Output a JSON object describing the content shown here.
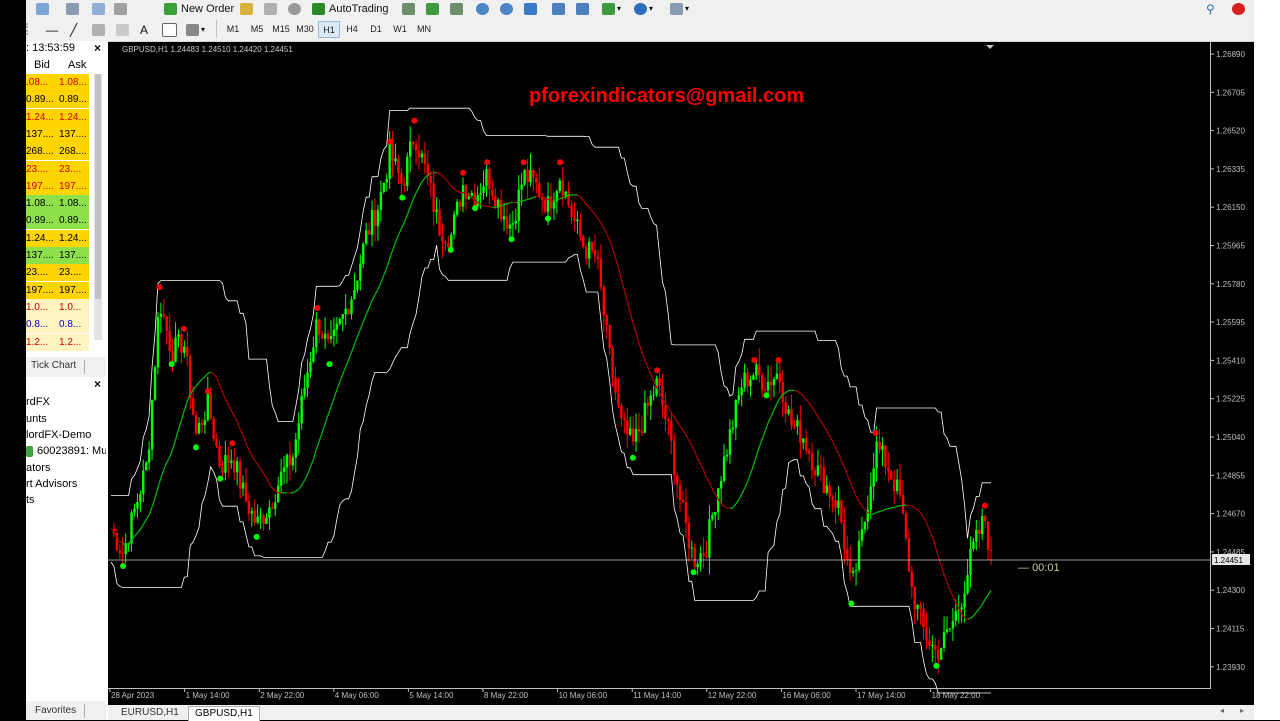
{
  "toolbar": {
    "new_order_label": "New Order",
    "autotrading_label": "AutoTrading",
    "timeframes": [
      "M1",
      "M5",
      "M15",
      "M30",
      "H1",
      "H4",
      "D1",
      "W1",
      "MN"
    ],
    "active_timeframe": "H1"
  },
  "market_watch": {
    "time": ": 13:53:59",
    "close_glyph": "×",
    "col_bid": "Bid",
    "col_ask": "Ask",
    "rows": [
      {
        "bid": ".08...",
        "ask": "1.08...",
        "color": "#ffd400",
        "text": "#d00000"
      },
      {
        "bid": "0.89...",
        "ask": "0.89...",
        "color": "#ffd400",
        "text": "#000000"
      },
      {
        "bid": "1.24...",
        "ask": "1.24...",
        "color": "#ffd400",
        "text": "#d00000"
      },
      {
        "bid": "137....",
        "ask": "137....",
        "color": "#ffd400",
        "text": "#000000"
      },
      {
        "bid": "268....",
        "ask": "268....",
        "color": "#ffd400",
        "text": "#000000"
      },
      {
        "bid": "23....",
        "ask": "23....",
        "color": "#ffd400",
        "text": "#d00000"
      },
      {
        "bid": "197....",
        "ask": "197....",
        "color": "#ffd400",
        "text": "#d00000"
      },
      {
        "bid": "1.08...",
        "ask": "1.08...",
        "color": "#8ee04a",
        "text": "#000000"
      },
      {
        "bid": "0.89...",
        "ask": "0.89...",
        "color": "#8ee04a",
        "text": "#000000"
      },
      {
        "bid": "1.24...",
        "ask": "1.24...",
        "color": "#ffd400",
        "text": "#000000"
      },
      {
        "bid": "137....",
        "ask": "137....",
        "color": "#8ee04a",
        "text": "#000000"
      },
      {
        "bid": "23....",
        "ask": "23....",
        "color": "#ffd400",
        "text": "#000000"
      },
      {
        "bid": "197....",
        "ask": "197....",
        "color": "#ffd400",
        "text": "#000000"
      },
      {
        "bid": "1.0...",
        "ask": "1.0...",
        "color": "#fff3c0",
        "text": "#d00000"
      },
      {
        "bid": "0.8...",
        "ask": "0.8...",
        "color": "#fff3c0",
        "text": "#0000c0"
      },
      {
        "bid": "1.2...",
        "ask": "1.2...",
        "color": "#fff3c0",
        "text": "#d00000"
      }
    ],
    "tick_chart_tab": "Tick Chart"
  },
  "navigator": {
    "close_glyph": "×",
    "items": [
      "rdFX",
      "unts",
      "lordFX-Demo",
      "60023891: Mu",
      "ators",
      "rt Advisors",
      "ts"
    ]
  },
  "favorites_tab": "Favorites",
  "bottom_tabs": [
    "EURUSD,H1",
    "GBPUSD,H1"
  ],
  "active_tab": "GBPUSD,H1",
  "chart": {
    "header": "GBPUSD,H1  1.24483 1.24510 1.24420 1.24451",
    "watermark": "pforexindicators@gmail.com",
    "price_labels": [
      "1.26890",
      "1.26705",
      "1.26520",
      "1.26335",
      "1.26150",
      "1.25965",
      "1.25780",
      "1.25595",
      "1.25410",
      "1.25225",
      "1.25040",
      "1.24855",
      "1.24670",
      "1.24485",
      "1.24300",
      "1.24115",
      "1.23930"
    ],
    "current_price": "1.24451",
    "countdown": "00:01",
    "time_labels": [
      "28 Apr 2023",
      "1 May 14:00",
      "2 May 22:00",
      "4 May 06:00",
      "5 May 14:00",
      "8 May 22:00",
      "10 May 06:00",
      "11 May 14:00",
      "12 May 22:00",
      "16 May 06:00",
      "17 May 14:00",
      "18 May 22:00"
    ],
    "colors": {
      "bull": "#00ff00",
      "bear": "#ff0000",
      "band": "#ffffff",
      "ma_bull": "#00c000",
      "ma_bear": "#b00000",
      "watermark": "#ff0000"
    },
    "price_path": [
      [
        0,
        1.246
      ],
      [
        2,
        1.2448
      ],
      [
        4,
        1.247
      ],
      [
        6,
        1.2492
      ],
      [
        8,
        1.257
      ],
      [
        10,
        1.2545
      ],
      [
        12,
        1.255
      ],
      [
        14,
        1.2505
      ],
      [
        16,
        1.252
      ],
      [
        18,
        1.249
      ],
      [
        20,
        1.2495
      ],
      [
        22,
        1.2475
      ],
      [
        24,
        1.2462
      ],
      [
        26,
        1.247
      ],
      [
        28,
        1.2485
      ],
      [
        30,
        1.2495
      ],
      [
        32,
        1.253
      ],
      [
        34,
        1.256
      ],
      [
        36,
        1.2545
      ],
      [
        38,
        1.256
      ],
      [
        40,
        1.2575
      ],
      [
        42,
        1.26
      ],
      [
        44,
        1.2615
      ],
      [
        46,
        1.264
      ],
      [
        48,
        1.2625
      ],
      [
        50,
        1.265
      ],
      [
        52,
        1.263
      ],
      [
        54,
        1.2605
      ],
      [
        56,
        1.26
      ],
      [
        58,
        1.2625
      ],
      [
        60,
        1.262
      ],
      [
        62,
        1.263
      ],
      [
        64,
        1.2615
      ],
      [
        66,
        1.2605
      ],
      [
        68,
        1.263
      ],
      [
        70,
        1.2625
      ],
      [
        72,
        1.2615
      ],
      [
        74,
        1.263
      ],
      [
        76,
        1.261
      ],
      [
        78,
        1.2595
      ],
      [
        80,
        1.259
      ],
      [
        82,
        1.2545
      ],
      [
        84,
        1.251
      ],
      [
        86,
        1.25
      ],
      [
        88,
        1.2515
      ],
      [
        90,
        1.253
      ],
      [
        92,
        1.2505
      ],
      [
        94,
        1.247
      ],
      [
        96,
        1.2445
      ],
      [
        98,
        1.245
      ],
      [
        100,
        1.248
      ],
      [
        102,
        1.2505
      ],
      [
        104,
        1.253
      ],
      [
        106,
        1.2535
      ],
      [
        108,
        1.253
      ],
      [
        110,
        1.2535
      ],
      [
        112,
        1.251
      ],
      [
        114,
        1.2505
      ],
      [
        116,
        1.249
      ],
      [
        118,
        1.248
      ],
      [
        120,
        1.247
      ],
      [
        122,
        1.243
      ],
      [
        124,
        1.246
      ],
      [
        126,
        1.25
      ],
      [
        128,
        1.249
      ],
      [
        130,
        1.2475
      ],
      [
        132,
        1.243
      ],
      [
        134,
        1.241
      ],
      [
        136,
        1.24
      ],
      [
        138,
        1.241
      ],
      [
        140,
        1.2425
      ],
      [
        142,
        1.245
      ],
      [
        144,
        1.2465
      ],
      [
        145,
        1.2445
      ]
    ]
  }
}
